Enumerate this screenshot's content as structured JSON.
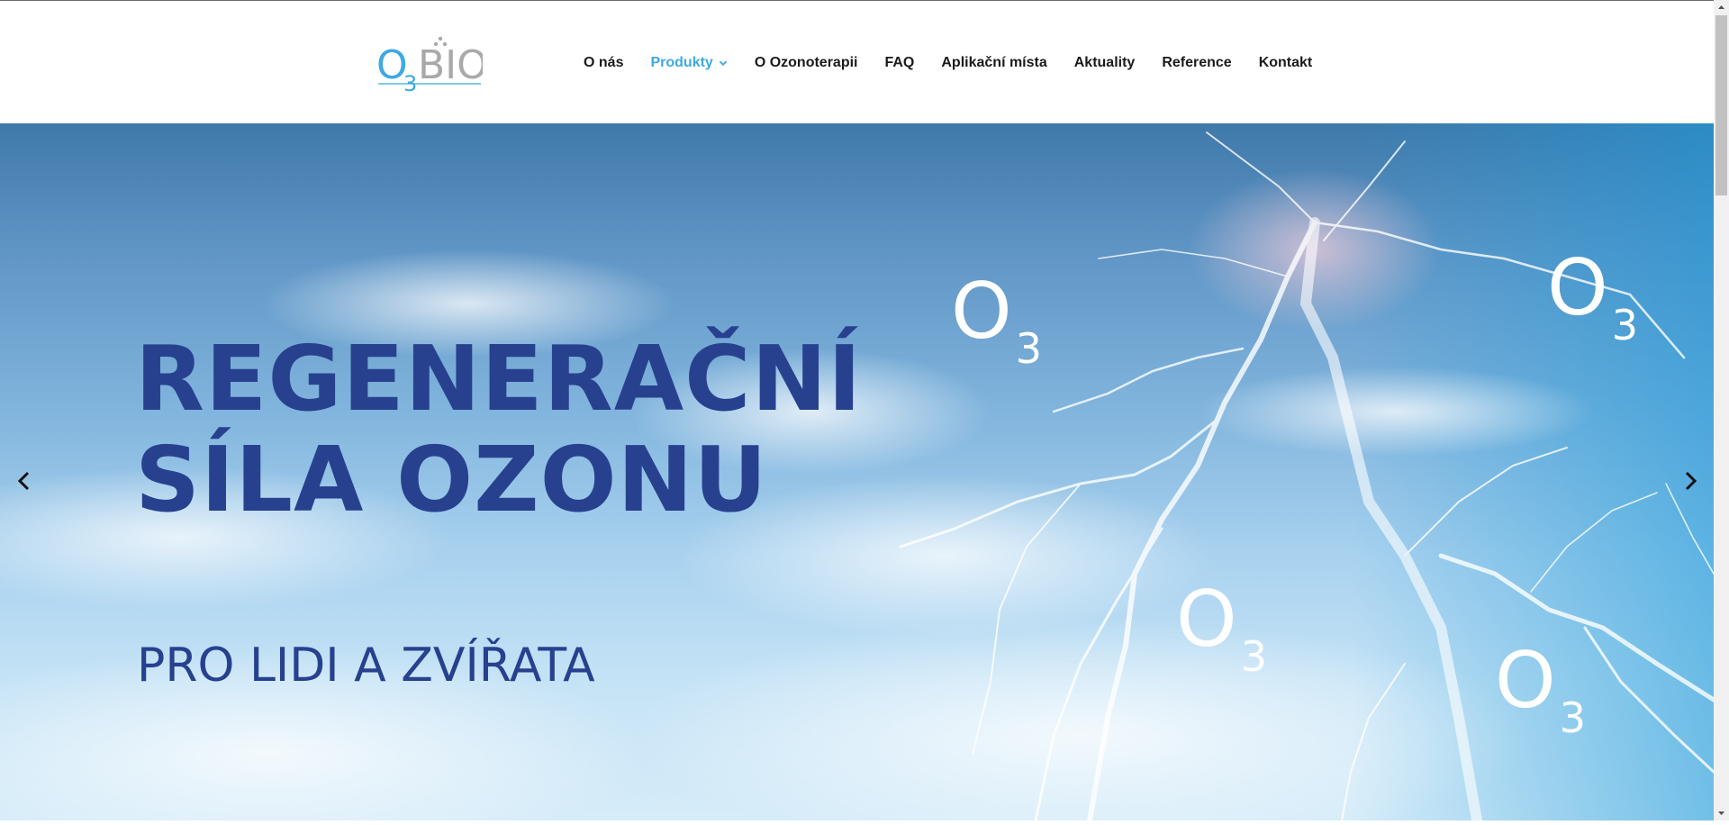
{
  "logo": {
    "text_o": "O",
    "text_3": "3",
    "text_bio": "BIO"
  },
  "nav": {
    "items": [
      {
        "label": "O nás"
      },
      {
        "label": "Produkty",
        "active": true,
        "has_dropdown": true
      },
      {
        "label": "O Ozonoterapii"
      },
      {
        "label": "FAQ"
      },
      {
        "label": "Aplikační místa"
      },
      {
        "label": "Aktuality"
      },
      {
        "label": "Reference"
      },
      {
        "label": "Kontakt"
      }
    ]
  },
  "hero": {
    "headline_line1": "REGENERAČNÍ",
    "headline_line2": "SÍLA OZONU",
    "subline": "PRO LIDI A ZVÍŘATA",
    "o3_marks": [
      {
        "o": "O",
        "sub": "3"
      },
      {
        "o": "O",
        "sub": "3"
      },
      {
        "o": "O",
        "sub": "3"
      },
      {
        "o": "O",
        "sub": "3"
      }
    ]
  },
  "icons": {
    "prev": "chevron-left-icon",
    "next": "chevron-right-icon",
    "dropdown": "chevron-down-icon"
  },
  "colors": {
    "headline": "#27418f",
    "nav_active": "#3fa9e0",
    "nav_text": "#1b1b1b",
    "logo_blue": "#3fa9e0",
    "logo_gray": "#a9a9a9"
  }
}
